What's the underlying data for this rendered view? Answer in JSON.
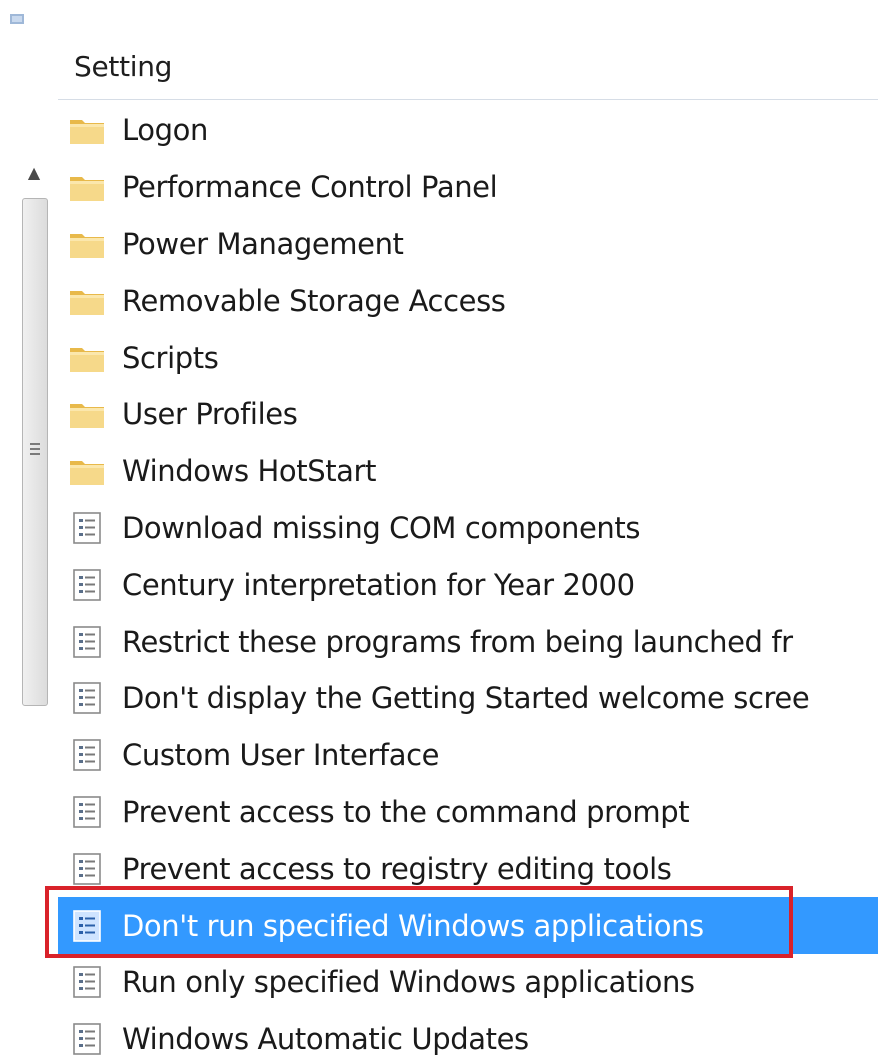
{
  "header": {
    "column_setting": "Setting"
  },
  "scrollbar": {
    "up_arrow": "▲"
  },
  "rows": [
    {
      "type": "folder",
      "label": "Logon"
    },
    {
      "type": "folder",
      "label": "Performance Control Panel"
    },
    {
      "type": "folder",
      "label": "Power Management"
    },
    {
      "type": "folder",
      "label": "Removable Storage Access"
    },
    {
      "type": "folder",
      "label": "Scripts"
    },
    {
      "type": "folder",
      "label": "User Profiles"
    },
    {
      "type": "folder",
      "label": "Windows HotStart"
    },
    {
      "type": "policy",
      "label": "Download missing COM components"
    },
    {
      "type": "policy",
      "label": "Century interpretation for Year 2000"
    },
    {
      "type": "policy",
      "label": "Restrict these programs from being launched fr"
    },
    {
      "type": "policy",
      "label": "Don't display the Getting Started welcome scree"
    },
    {
      "type": "policy",
      "label": "Custom User Interface"
    },
    {
      "type": "policy",
      "label": "Prevent access to the command prompt"
    },
    {
      "type": "policy",
      "label": "Prevent access to registry editing tools"
    },
    {
      "type": "policy",
      "label": "Don't run specified Windows applications",
      "selected": true
    },
    {
      "type": "policy",
      "label": "Run only specified Windows applications"
    },
    {
      "type": "policy",
      "label": "Windows Automatic Updates"
    }
  ],
  "icons": {
    "folder": "folder-icon",
    "policy": "policy-setting-icon"
  },
  "colors": {
    "selection": "#3399ff",
    "highlight_border": "#d9222a",
    "folder": "#f3d27a"
  }
}
